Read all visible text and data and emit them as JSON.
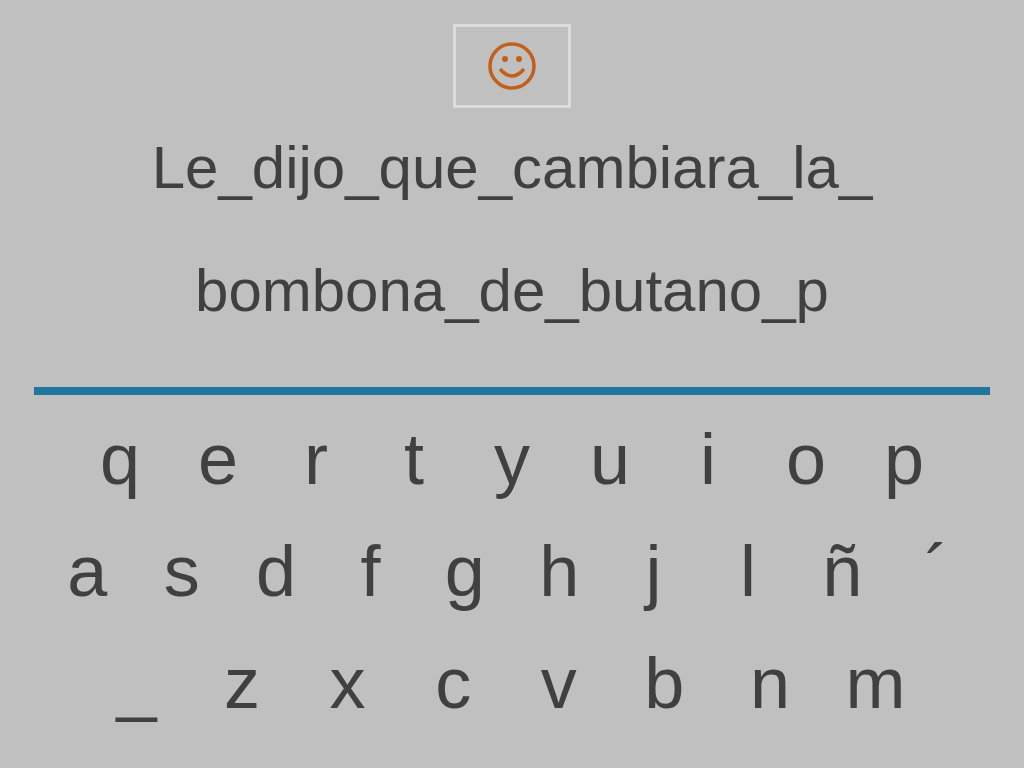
{
  "phrase_lines": [
    "Le_dijo_que_cambiara_la_",
    "bombona_de_butano_p"
  ],
  "keyboard": {
    "rows": [
      [
        "q",
        "e",
        "r",
        "t",
        "y",
        "u",
        "i",
        "o",
        "p"
      ],
      [
        "a",
        "s",
        "d",
        "f",
        "g",
        "h",
        "j",
        "l",
        "ñ",
        "´"
      ],
      [
        "_",
        "z",
        "x",
        "c",
        "v",
        "b",
        "n",
        "m"
      ]
    ]
  }
}
